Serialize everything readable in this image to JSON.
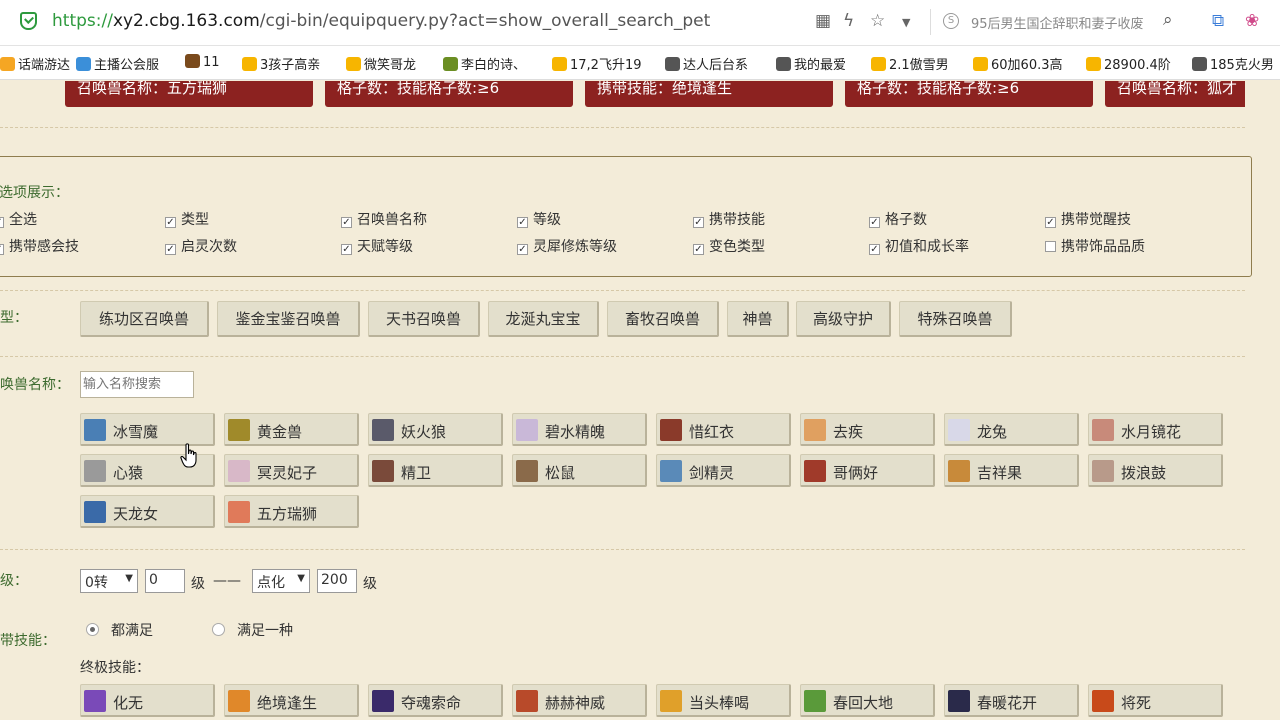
{
  "browser": {
    "url_scheme": "https://",
    "url_host": "xy2.cbg.163.com",
    "url_path": "/cgi-bin/equipquery.py?act=show_overall_search_pet",
    "search_text": "95后男生国企辞职和妻子收废"
  },
  "bookmarks": [
    {
      "label": "话端游达",
      "color": "#f5a623"
    },
    {
      "label": "主播公会服",
      "color": "#3b8fd9"
    },
    {
      "label": "11",
      "color": "#7a4a1c"
    },
    {
      "label": "3孩子高亲",
      "color": "#f7b500"
    },
    {
      "label": "微笑哥龙",
      "color": "#f7b500"
    },
    {
      "label": "李白的诗、",
      "color": "#6b8e23"
    },
    {
      "label": "17,2飞升19",
      "color": "#f7b500"
    },
    {
      "label": "达人后台系",
      "color": "#555555"
    },
    {
      "label": "我的最爱",
      "color": "#555555"
    },
    {
      "label": "2.1傲雪男",
      "color": "#f7b500"
    },
    {
      "label": "60加60.3高",
      "color": "#f7b500"
    },
    {
      "label": "28900.4阶",
      "color": "#f7b500"
    },
    {
      "label": "185克火男",
      "color": "#555555"
    }
  ],
  "active_filters": [
    "召唤兽名称：五方瑞狮",
    "格子数：技能格子数:≥6",
    "携带技能：绝境逢生",
    "格子数：技能格子数:≥6",
    "召唤兽名称：狐才"
  ],
  "options": {
    "label": "选项展示：",
    "checkboxes": [
      {
        "label": "全选",
        "checked": true
      },
      {
        "label": "类型",
        "checked": true
      },
      {
        "label": "召唤兽名称",
        "checked": true
      },
      {
        "label": "等级",
        "checked": true
      },
      {
        "label": "携带技能",
        "checked": true
      },
      {
        "label": "格子数",
        "checked": true
      },
      {
        "label": "携带觉醒技",
        "checked": true
      },
      {
        "label": "携带感会技",
        "checked": true
      },
      {
        "label": "启灵次数",
        "checked": true
      },
      {
        "label": "天赋等级",
        "checked": true
      },
      {
        "label": "灵犀修炼等级",
        "checked": true
      },
      {
        "label": "变色类型",
        "checked": true
      },
      {
        "label": "初值和成长率",
        "checked": true
      },
      {
        "label": "携带饰品品质",
        "checked": false
      }
    ]
  },
  "type_section": {
    "label": "型：",
    "buttons": [
      "练功区召唤兽",
      "鉴金宝鉴召唤兽",
      "天书召唤兽",
      "龙涎丸宝宝",
      "畜牧召唤兽",
      "神兽",
      "高级守护",
      "特殊召唤兽"
    ]
  },
  "name_section": {
    "label": "唤兽名称：",
    "search_placeholder": "输入名称搜索",
    "pets": [
      {
        "name": "冰雪魔",
        "color": "#4a7fb5"
      },
      {
        "name": "黄金兽",
        "color": "#a08a2a"
      },
      {
        "name": "妖火狼",
        "color": "#5a5a6a"
      },
      {
        "name": "碧水精魄",
        "color": "#c9b8d8"
      },
      {
        "name": "惜红衣",
        "color": "#8a3a2a"
      },
      {
        "name": "去疾",
        "color": "#e0a060"
      },
      {
        "name": "龙兔",
        "color": "#d8d8e8"
      },
      {
        "name": "水月镜花",
        "color": "#c88a7a"
      },
      {
        "name": "心猿",
        "color": "#9a9a9a"
      },
      {
        "name": "冥灵妃子",
        "color": "#d8b8c8"
      },
      {
        "name": "精卫",
        "color": "#7a4a3a"
      },
      {
        "name": "松鼠",
        "color": "#8a6a4a"
      },
      {
        "name": "剑精灵",
        "color": "#5a8ab8"
      },
      {
        "name": "哥俩好",
        "color": "#a03a2a"
      },
      {
        "name": "吉祥果",
        "color": "#c88a3a"
      },
      {
        "name": "拨浪鼓",
        "color": "#b89a8a"
      },
      {
        "name": "天龙女",
        "color": "#3a6aa8"
      },
      {
        "name": "五方瑞狮",
        "color": "#e07a5a"
      }
    ]
  },
  "level_section": {
    "label": "级：",
    "from_select": "0转",
    "from_value": "0",
    "unit": "级",
    "separator": "——",
    "to_select": "点化",
    "to_value": "200"
  },
  "skill_section": {
    "label": "带技能：",
    "radio_all": "都满足",
    "radio_any": "满足一种",
    "ultimate_label": "终极技能：",
    "skills": [
      {
        "name": "化无",
        "color": "#7a4ab8"
      },
      {
        "name": "绝境逢生",
        "color": "#e0882a"
      },
      {
        "name": "夺魂索命",
        "color": "#3a2a6a"
      },
      {
        "name": "赫赫神威",
        "color": "#b84a2a"
      },
      {
        "name": "当头棒喝",
        "color": "#e0a02a"
      },
      {
        "name": "春回大地",
        "color": "#5a9a3a"
      },
      {
        "name": "春暖花开",
        "color": "#2a2a4a"
      },
      {
        "name": "将死",
        "color": "#c84a1a"
      }
    ]
  }
}
